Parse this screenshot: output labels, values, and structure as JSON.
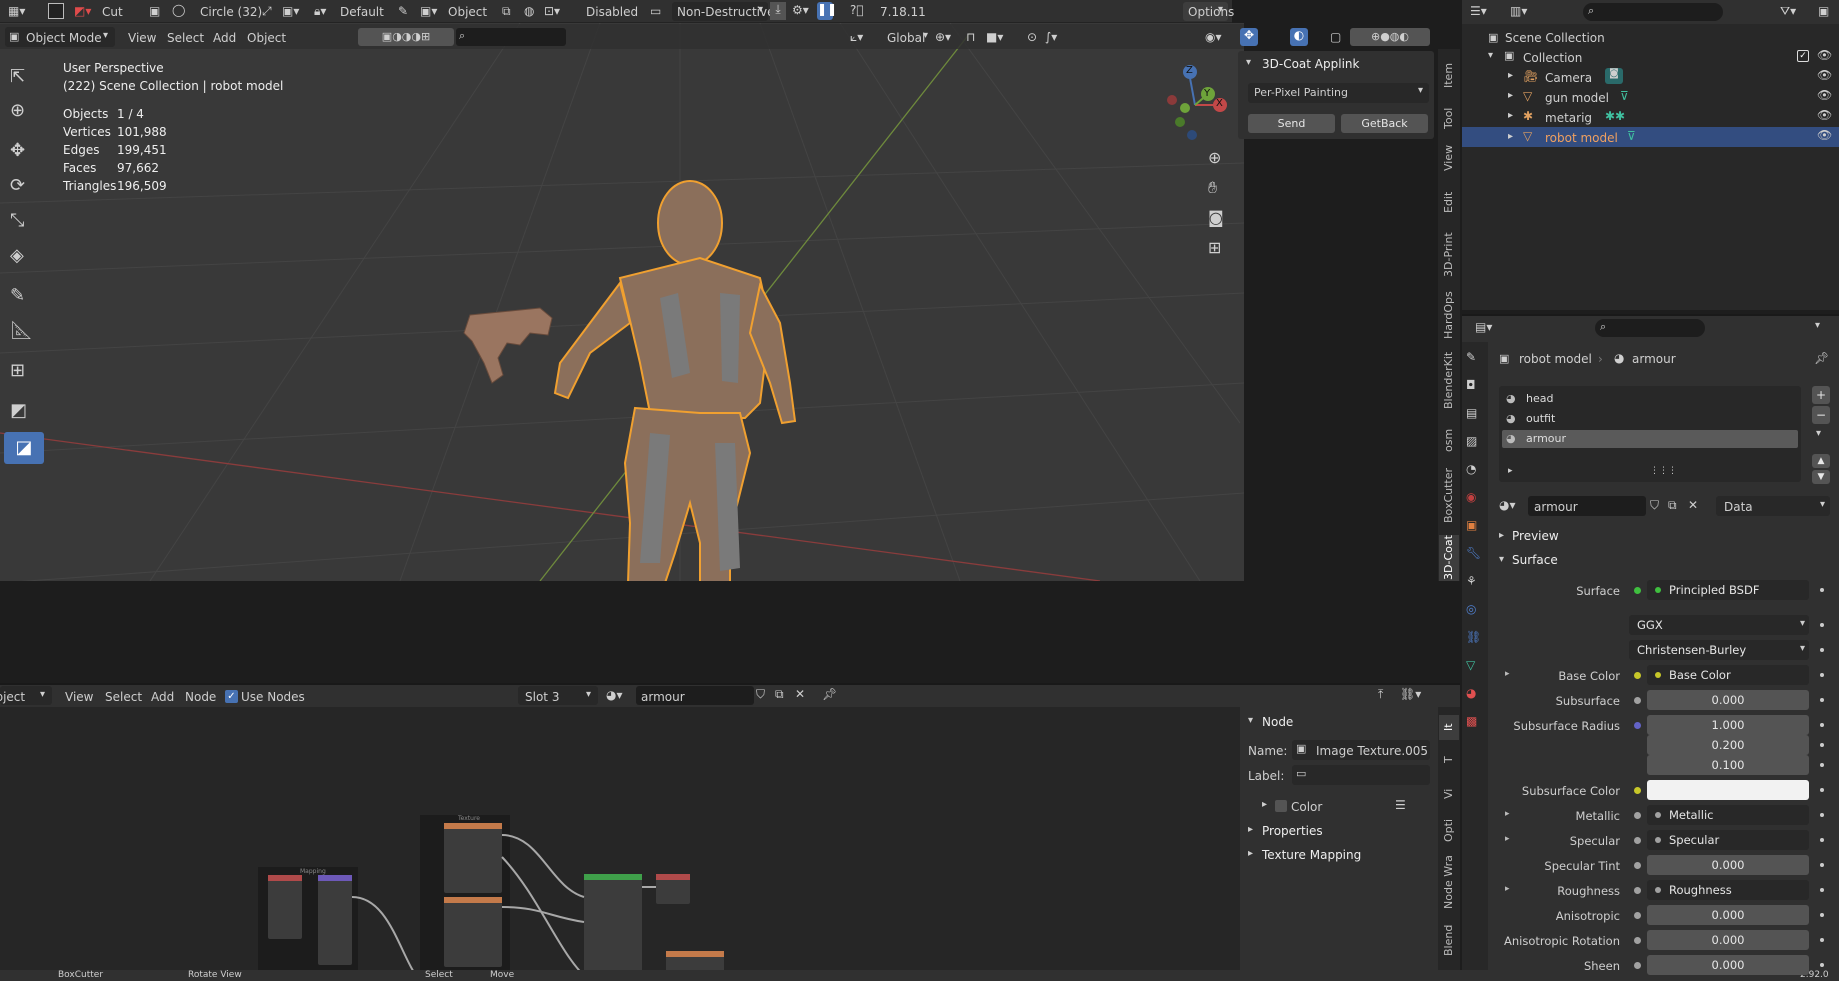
{
  "topbar": {
    "tool": "Cut",
    "brush": "Circle (32)",
    "lock": "Default",
    "object": "Object",
    "snap": "Disabled",
    "mode2": "Non-Destructive",
    "version": "7.18.11",
    "options": "Options"
  },
  "vp_header": {
    "mode": "Object Mode",
    "menus": [
      "View",
      "Select",
      "Add",
      "Object"
    ],
    "orientation": "Global"
  },
  "vp_info": {
    "line1": "User Perspective",
    "line2": "(222) Scene Collection | robot model",
    "stats": [
      {
        "k": "Objects",
        "v": "1 / 4"
      },
      {
        "k": "Vertices",
        "v": "101,988"
      },
      {
        "k": "Edges",
        "v": "199,451"
      },
      {
        "k": "Faces",
        "v": "97,662"
      },
      {
        "k": "Triangles",
        "v": "196,509"
      }
    ]
  },
  "applink": {
    "title": "3D-Coat Applink",
    "mode": "Per-Pixel Painting",
    "send": "Send",
    "getback": "GetBack"
  },
  "vp_tabs": [
    "Item",
    "Tool",
    "View",
    "Edit",
    "3D-Print",
    "HardOps",
    "BlenderKit",
    "osm",
    "BoxCutter",
    "3D-Coat"
  ],
  "gizmo": {
    "x": "X",
    "y": "Y",
    "z": "Z"
  },
  "outliner": {
    "root": "Scene Collection",
    "collection": "Collection",
    "items": [
      "Camera",
      "gun model",
      "metarig",
      "robot model"
    ]
  },
  "props": {
    "breadcrumb_obj": "robot model",
    "breadcrumb_mat": "armour",
    "slots": [
      "head",
      "outfit",
      "armour"
    ],
    "mat_name": "armour",
    "link": "Data",
    "preview": "Preview",
    "surface_section": "Surface",
    "rows": [
      {
        "label": "Surface",
        "value": "Principled BSDF",
        "kind": "link",
        "dot": "#3fbf3f"
      },
      {
        "label": "",
        "value": "GGX",
        "kind": "drop"
      },
      {
        "label": "",
        "value": "Christensen-Burley",
        "kind": "drop"
      },
      {
        "label": "Base Color",
        "value": "Base Color",
        "kind": "link",
        "dot": "#c7c729",
        "arrow": true
      },
      {
        "label": "Subsurface",
        "value": "0.000",
        "kind": "num",
        "dot": "#a1a1a1"
      },
      {
        "label": "Subsurface Radius",
        "value": "1.000",
        "kind": "num",
        "dot": "#6363c7"
      },
      {
        "label": "",
        "value": "0.200",
        "kind": "num"
      },
      {
        "label": "",
        "value": "0.100",
        "kind": "num"
      },
      {
        "label": "Subsurface Color",
        "value": "",
        "kind": "color",
        "dot": "#c7c729"
      },
      {
        "label": "Metallic",
        "value": "Metallic",
        "kind": "link",
        "dot": "#a1a1a1",
        "arrow": true
      },
      {
        "label": "Specular",
        "value": "Specular",
        "kind": "link",
        "dot": "#a1a1a1",
        "arrow": true
      },
      {
        "label": "Specular Tint",
        "value": "0.000",
        "kind": "num",
        "dot": "#a1a1a1"
      },
      {
        "label": "Roughness",
        "value": "Roughness",
        "kind": "link",
        "dot": "#a1a1a1",
        "arrow": true
      },
      {
        "label": "Anisotropic",
        "value": "0.000",
        "kind": "num",
        "dot": "#a1a1a1"
      },
      {
        "label": "Anisotropic Rotation",
        "value": "0.000",
        "kind": "num",
        "dot": "#a1a1a1"
      },
      {
        "label": "Sheen",
        "value": "0.000",
        "kind": "num",
        "dot": "#a1a1a1"
      }
    ]
  },
  "node_header": {
    "mode": "Object",
    "menus": [
      "View",
      "Select",
      "Add",
      "Node"
    ],
    "use_nodes": "Use Nodes",
    "slot": "Slot 3",
    "material": "armour"
  },
  "node_panel": {
    "title": "Node",
    "name_label": "Name:",
    "name_value": "Image Texture.005",
    "label_label": "Label:",
    "color": "Color",
    "properties": "Properties",
    "texture_mapping": "Texture Mapping"
  },
  "node_tabs": [
    "It",
    "T",
    "Vi",
    "Opti",
    "Node Wra",
    "Blend"
  ],
  "node_frames": {
    "texture": "Texture",
    "mapping": "Mapping"
  },
  "status": {
    "a": "BoxCutter",
    "b": "Rotate View",
    "c": "Select",
    "d": "Move",
    "ver": "2.92.0"
  }
}
